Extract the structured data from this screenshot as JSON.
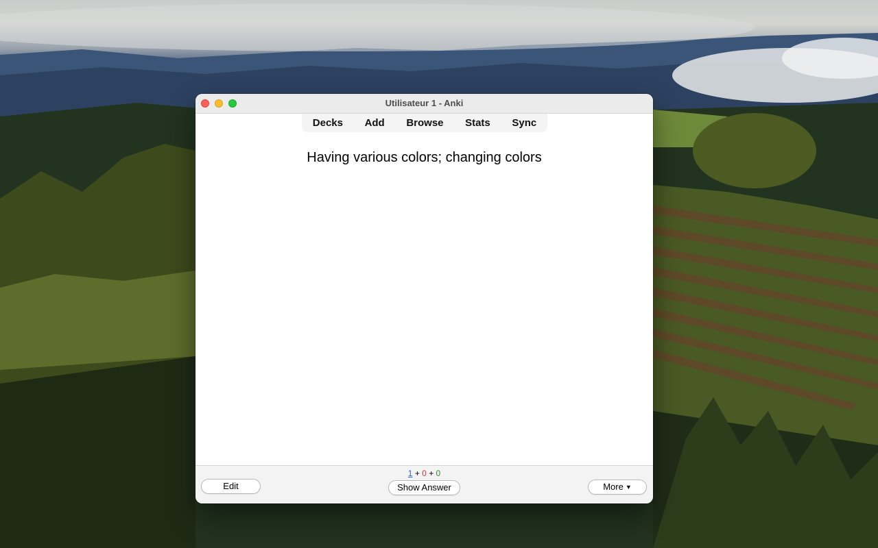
{
  "window": {
    "title": "Utilisateur 1 - Anki"
  },
  "toolbar": {
    "items": [
      "Decks",
      "Add",
      "Browse",
      "Stats",
      "Sync"
    ]
  },
  "card": {
    "question": "Having various colors; changing colors"
  },
  "bottom_bar": {
    "edit_label": "Edit",
    "show_answer_label": "Show Answer",
    "more_label": "More",
    "counts": {
      "new": "1",
      "learning": "0",
      "review": "0",
      "separator": "+"
    }
  },
  "colors": {
    "new_count": "#2a63e0",
    "learning_count": "#c83535",
    "review_count": "#2b8b2b",
    "close": "#fe5f57",
    "minimize": "#febc2e",
    "maximize": "#28c840"
  },
  "icons": {
    "more_caret": "chevron-down-icon"
  }
}
